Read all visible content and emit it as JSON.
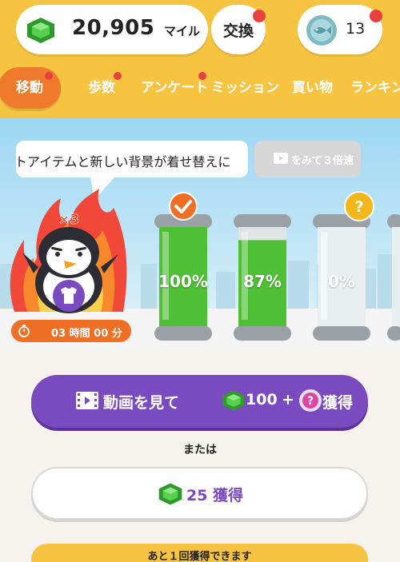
{
  "header": {
    "miles_value": "20,905",
    "miles_unit": "マイル",
    "exchange_label": "交換",
    "coin_count": "13",
    "icons": [
      "green-gem-icon",
      "fish-coin-icon"
    ]
  },
  "tabs": [
    {
      "label": "移動",
      "active": true,
      "dot": true
    },
    {
      "label": "歩数",
      "active": false,
      "dot": true
    },
    {
      "label": "アンケート",
      "active": false,
      "dot": true
    },
    {
      "label": "ミッション",
      "active": false,
      "dot": false
    },
    {
      "label": "買い物",
      "active": false,
      "dot": false
    },
    {
      "label": "ランキン",
      "active": false,
      "dot": false
    }
  ],
  "hero": {
    "bubble_text": "トアイテムと新しい背景が着せ替えに",
    "video_button_label": "をみて３倍速",
    "multiplier_badge": "×3",
    "timer_text": "03 時間 00 分",
    "tanks": [
      {
        "percent": "100%",
        "fill": 1.0,
        "badge": "check"
      },
      {
        "percent": "87%",
        "fill": 0.87,
        "badge": null
      },
      {
        "percent": "0%",
        "fill": 0.0,
        "badge": "?"
      }
    ]
  },
  "actions": {
    "watch_label_1": "動画を見て",
    "watch_amount": "100",
    "watch_plus": "+",
    "watch_question": "?",
    "watch_label_2": "獲得",
    "or_label": "または",
    "get_label": "25 獲得",
    "remaining_label": "あと１回獲得できます"
  },
  "colors": {
    "header_yellow": "#f7c441",
    "active_tab_orange": "#ef7a2b",
    "purple": "#7a4bc0",
    "notification_red": "#e94040",
    "gem_green": "#3fb83a"
  }
}
